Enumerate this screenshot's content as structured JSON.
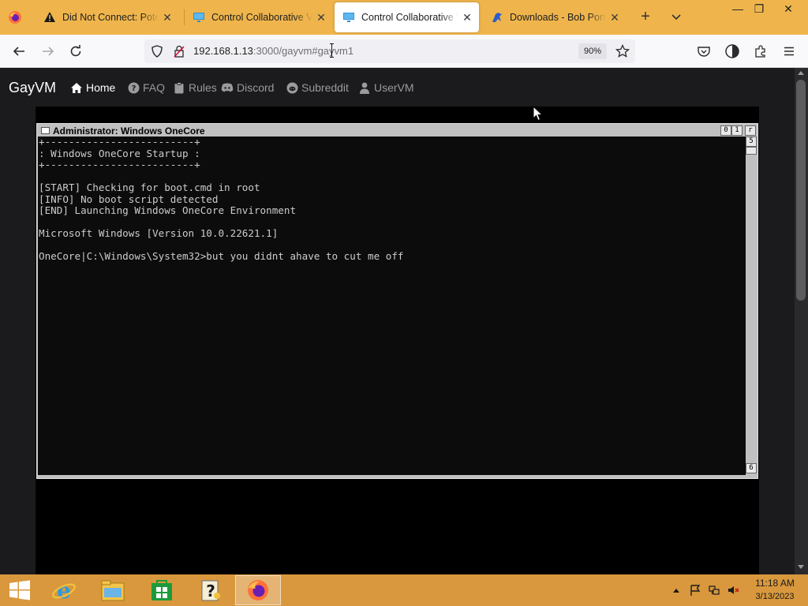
{
  "browser": {
    "tabs": [
      {
        "title": "Did Not Connect: Potential Security Issue",
        "icon": "warning-icon",
        "active": false
      },
      {
        "title": "Control Collaborative Virtual Machines",
        "icon": "monitor-icon",
        "active": false
      },
      {
        "title": "Control Collaborative Virtual Machines",
        "icon": "monitor-icon",
        "active": true
      },
      {
        "title": "Downloads - Bob Pony",
        "icon": "bobpony-icon",
        "active": false
      }
    ],
    "close_glyph": "✕",
    "new_tab_glyph": "+",
    "window_controls": {
      "minimize": "—",
      "maximize": "❐",
      "close": "✕"
    },
    "url": {
      "host": "192.168.1.13",
      "rest": ":3000/gayvm#gayvm1"
    },
    "zoom": "90%"
  },
  "site": {
    "brand": "GayVM",
    "nav": [
      {
        "label": "Home",
        "icon": "home-icon",
        "active": true
      },
      {
        "label": "FAQ",
        "icon": "question-icon",
        "active": false
      },
      {
        "label": "Rules",
        "icon": "clipboard-icon",
        "active": false
      },
      {
        "label": "Discord",
        "icon": "discord-icon",
        "active": false
      },
      {
        "label": "Subreddit",
        "icon": "reddit-icon",
        "active": false
      },
      {
        "label": "UserVM",
        "icon": "user-icon",
        "active": false
      }
    ]
  },
  "console": {
    "title": "Administrator:  Windows OneCore",
    "buttons": [
      "0",
      "1",
      "r"
    ],
    "scroll_up_glyph": "5",
    "scroll_down_glyph": "6",
    "lines": [
      "+-------------------------+",
      ": Windows OneCore Startup :",
      "+-------------------------+",
      "",
      "[START] Checking for boot.cmd in root",
      "[INFO] No boot script detected",
      "[END] Launching Windows OneCore Environment",
      "",
      "Microsoft Windows [Version 10.0.22621.1]",
      "",
      "OneCore|C:\\Windows\\System32>but you didnt ahave to cut me off"
    ]
  },
  "taskbar": {
    "apps": [
      {
        "name": "internet-explorer",
        "icon": "ie-icon",
        "active": false
      },
      {
        "name": "file-explorer",
        "icon": "folder-icon",
        "active": false
      },
      {
        "name": "store",
        "icon": "store-icon",
        "active": false
      },
      {
        "name": "help",
        "icon": "help-icon",
        "active": false
      },
      {
        "name": "firefox",
        "icon": "firefox-icon",
        "active": true
      }
    ],
    "clock": {
      "time": "11:18 AM",
      "date": "3/13/2023"
    }
  },
  "colors": {
    "tab_strip": "#efb54c",
    "taskbar": "#d9983d",
    "page_bg": "#1b1b1d",
    "console_bg": "#0c0c0c",
    "console_text": "#cccccc"
  }
}
